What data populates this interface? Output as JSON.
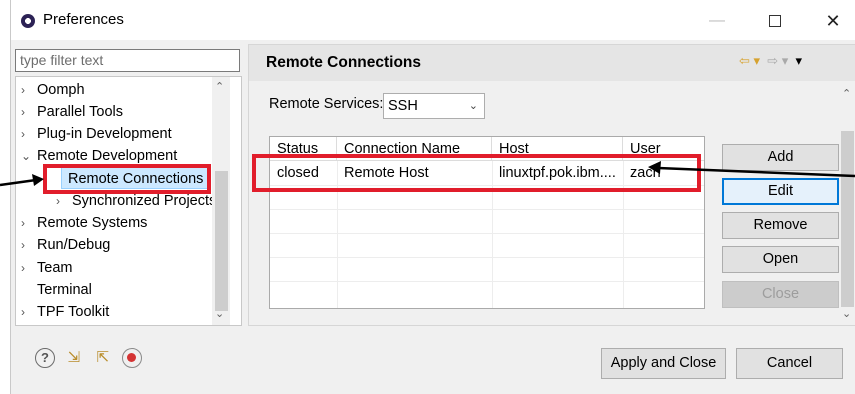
{
  "window": {
    "title": "Preferences",
    "minimize_glyph": "—",
    "close_glyph": "✕"
  },
  "filter": {
    "placeholder": "type filter text"
  },
  "tree": {
    "items": [
      {
        "label": "Oomph",
        "chevron": "›"
      },
      {
        "label": "Parallel Tools",
        "chevron": "›"
      },
      {
        "label": "Plug-in Development",
        "chevron": "›"
      },
      {
        "label": "Remote Development",
        "chevron": "⌄"
      },
      {
        "label": "Remote Connections",
        "chevron": ""
      },
      {
        "label": "Synchronized Projects",
        "chevron": "›"
      },
      {
        "label": "Remote Systems",
        "chevron": "›"
      },
      {
        "label": "Run/Debug",
        "chevron": "›"
      },
      {
        "label": "Team",
        "chevron": "›"
      },
      {
        "label": "Terminal",
        "chevron": ""
      },
      {
        "label": "TPF Toolkit",
        "chevron": "›"
      }
    ],
    "selected": "Remote Connections"
  },
  "page": {
    "title": "Remote Connections",
    "services_label": "Remote Services:",
    "services_value": "SSH"
  },
  "table": {
    "columns": [
      "Status",
      "Connection Name",
      "Host",
      "User"
    ],
    "rows": [
      {
        "status": "closed",
        "name": "Remote Host",
        "host": "linuxtpf.pok.ibm....",
        "user": "zach"
      }
    ]
  },
  "buttons": {
    "add": "Add",
    "edit": "Edit",
    "remove": "Remove",
    "open": "Open",
    "close": "Close",
    "apply_close": "Apply and Close",
    "cancel": "Cancel"
  },
  "icons": {
    "help": "help-icon",
    "import": "import-icon",
    "export": "export-icon",
    "record": "record-icon"
  },
  "colors": {
    "highlight": "#e11d2b",
    "selection": "#cce8ff",
    "focus": "#0078d7"
  }
}
